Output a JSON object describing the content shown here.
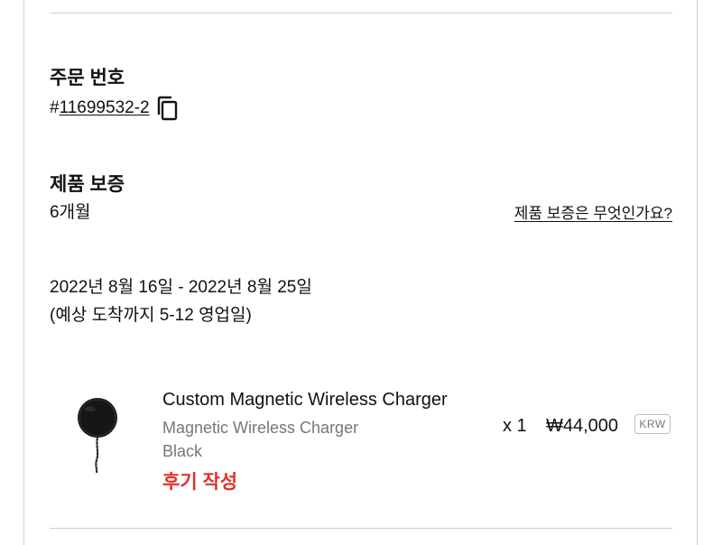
{
  "order": {
    "label": "주문 번호",
    "hash": "#",
    "number": "11699532-2",
    "copy_icon": "copy-icon"
  },
  "warranty": {
    "label": "제품 보증",
    "value": "6개월",
    "link": "제품 보증은 무엇인가요?"
  },
  "delivery": {
    "dates": "2022년 8월 16일 - 2022년 8월 25일",
    "note": "(예상 도착까지 5-12 영업일)"
  },
  "product": {
    "name": "Custom Magnetic Wireless Charger",
    "variant": "Magnetic Wireless Charger",
    "color": "Black",
    "review_label": "후기 작성",
    "quantity": "x 1",
    "price": "₩44,000",
    "currency": "KRW"
  },
  "colors": {
    "accent_red": "#e4312b",
    "muted_text": "#777777",
    "divider": "#cfcfcf"
  }
}
